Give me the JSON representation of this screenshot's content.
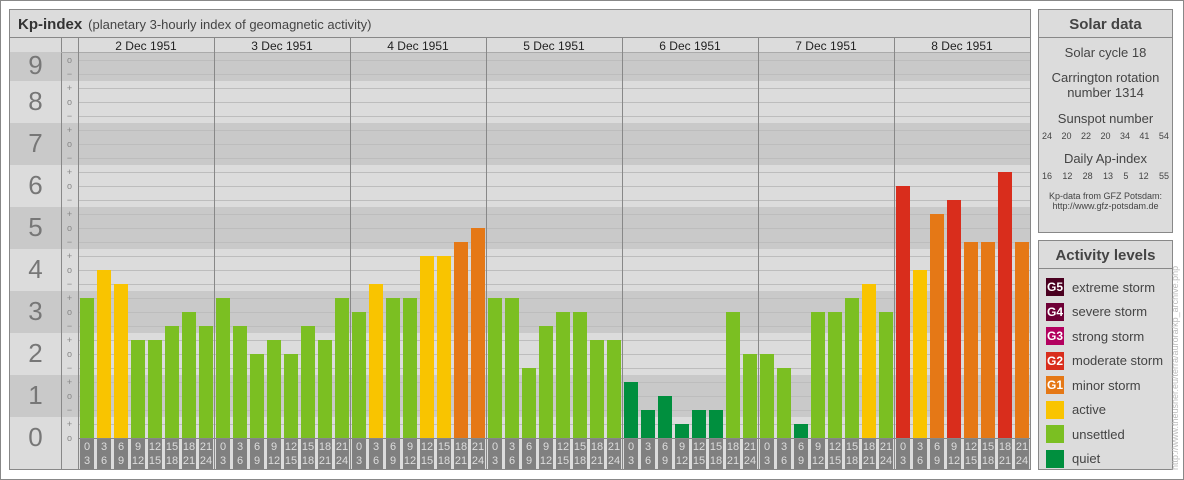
{
  "chart_data": {
    "type": "bar",
    "title": "Kp-index",
    "subtitle": "(planetary 3-hourly index of geomagnetic activity)",
    "ylabel": "Kp",
    "ylim": [
      0,
      9
    ],
    "y_ticks": [
      "0",
      "1",
      "2",
      "3",
      "4",
      "5",
      "6",
      "7",
      "8",
      "9"
    ],
    "third_marks": {
      "minus": "−",
      "zero": "o",
      "plus": "+"
    },
    "days": [
      "2 Dec 1951",
      "3 Dec 1951",
      "4 Dec 1951",
      "5 Dec 1951",
      "6 Dec 1951",
      "7 Dec 1951",
      "8 Dec 1951"
    ],
    "hour_start": [
      "0",
      "3",
      "6",
      "9",
      "12",
      "15",
      "18",
      "21"
    ],
    "hour_end": [
      "3",
      "6",
      "9",
      "12",
      "15",
      "18",
      "21",
      "24"
    ],
    "series": [
      {
        "name": "2 Dec 1951",
        "values": [
          "3+",
          "4o",
          "4-",
          "2+",
          "2+",
          "3-",
          "3o",
          "3-"
        ]
      },
      {
        "name": "3 Dec 1951",
        "values": [
          "3+",
          "3-",
          "2o",
          "2+",
          "2o",
          "3-",
          "2+",
          "3+"
        ]
      },
      {
        "name": "4 Dec 1951",
        "values": [
          "3o",
          "4-",
          "3+",
          "3+",
          "4+",
          "4+",
          "5-",
          "5o"
        ]
      },
      {
        "name": "5 Dec 1951",
        "values": [
          "3+",
          "3+",
          "2-",
          "3-",
          "3o",
          "3o",
          "2+",
          "2+"
        ]
      },
      {
        "name": "6 Dec 1951",
        "values": [
          "1+",
          "1-",
          "1o",
          "0+",
          "1-",
          "1-",
          "3o",
          "2o"
        ]
      },
      {
        "name": "7 Dec 1951",
        "values": [
          "2o",
          "2-",
          "0+",
          "3o",
          "3o",
          "3+",
          "4-",
          "3o"
        ]
      },
      {
        "name": "8 Dec 1951",
        "values": [
          "6o",
          "4o",
          "5+",
          "6-",
          "5-",
          "5-",
          "6+",
          "5-"
        ]
      }
    ]
  },
  "colors": {
    "quiet": "#008f3e",
    "unsettled": "#7bbf22",
    "active": "#f9c400",
    "G1": "#e57816",
    "G2": "#d92d1c",
    "G3": "#b3005f",
    "G4": "#6e0036",
    "G5": "#4a0020"
  },
  "solar": {
    "title": "Solar data",
    "cycle": "Solar cycle 18",
    "carrington1": "Carrington rotation",
    "carrington2": "number 1314",
    "sunspot_label": "Sunspot number",
    "sunspots": [
      "24",
      "20",
      "22",
      "20",
      "34",
      "41",
      "54"
    ],
    "ap_label": "Daily Ap-index",
    "ap": [
      "16",
      "12",
      "28",
      "13",
      "5",
      "12",
      "55"
    ],
    "source1": "Kp-data from  GFZ Potsdam:",
    "source2": "http://www.gfz-potsdam.de"
  },
  "legend": {
    "title": "Activity levels",
    "items": [
      {
        "badge": "G5",
        "label": "extreme storm",
        "color": "G5"
      },
      {
        "badge": "G4",
        "label": "severe storm",
        "color": "G4"
      },
      {
        "badge": "G3",
        "label": "strong storm",
        "color": "G3"
      },
      {
        "badge": "G2",
        "label": "moderate storm",
        "color": "G2"
      },
      {
        "badge": "G1",
        "label": "minor storm",
        "color": "G1"
      },
      {
        "badge": "",
        "label": "active",
        "color": "active"
      },
      {
        "badge": "",
        "label": "unsettled",
        "color": "unsettled"
      },
      {
        "badge": "",
        "label": "quiet",
        "color": "quiet"
      }
    ]
  },
  "watermark": "http://www.theusner.eu/terra/aurora/kp_archive.php"
}
